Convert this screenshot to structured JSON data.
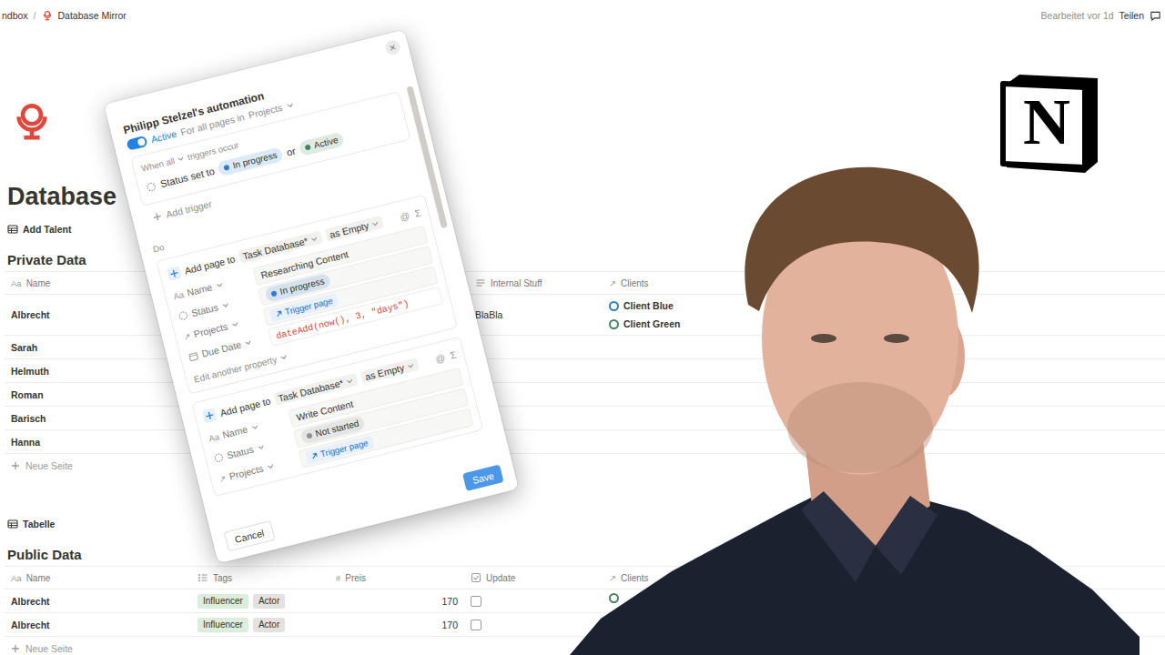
{
  "breadcrumb": {
    "items": [
      {
        "label": "ndbox"
      },
      {
        "label": "Database Mirror"
      }
    ],
    "separator": "/"
  },
  "topbar": {
    "edited": "Bearbeitet vor 1d",
    "share": "Teilen"
  },
  "page": {
    "title": "Database"
  },
  "sections": [
    {
      "view": "Add Talent",
      "heading": "Private Data",
      "columns": [
        {
          "label": "Name",
          "kind": "title",
          "icon": "Aa"
        },
        {
          "label": "Internal Stuff",
          "kind": "text"
        },
        {
          "label": "Clients",
          "kind": "relation",
          "icon": "↗"
        }
      ],
      "rows": [
        {
          "cells": [
            "Albrecht",
            "BlaBla",
            [
              {
                "label": "Client Blue",
                "color": "#2f7fb8"
              },
              {
                "label": "Client Green",
                "color": "#448361"
              }
            ]
          ]
        },
        {
          "cells": [
            "Sarah"
          ]
        },
        {
          "cells": [
            "Helmuth"
          ]
        },
        {
          "cells": [
            "Roman"
          ]
        },
        {
          "cells": [
            "Barisch"
          ]
        },
        {
          "cells": [
            "Hanna"
          ]
        }
      ],
      "new_page": "Neue Seite"
    },
    {
      "view": "Tabelle",
      "heading": "Public Data",
      "columns": [
        {
          "label": "Name",
          "kind": "title",
          "icon": "Aa"
        },
        {
          "label": "Tags",
          "kind": "multi"
        },
        {
          "label": "Preis",
          "kind": "number",
          "icon": "#"
        },
        {
          "label": "Update",
          "kind": "checkbox"
        },
        {
          "label": "Clients",
          "kind": "relation",
          "icon": "↗"
        }
      ],
      "rows": [
        {
          "cells": [
            "Albrecht",
            [
              {
                "label": "Influencer",
                "color": "#dbeddb"
              },
              {
                "label": "Actor",
                "color": "#e3e2e0"
              }
            ],
            "170",
            false,
            [
              {
                "color": "#448361"
              }
            ]
          ]
        },
        {
          "cells": [
            "Albrecht",
            [
              {
                "label": "Influencer",
                "color": "#dbeddb"
              },
              {
                "label": "Actor",
                "color": "#e3e2e0"
              }
            ],
            "170",
            false
          ]
        }
      ],
      "new_page": "Neue Seite"
    }
  ],
  "automation": {
    "close": "×",
    "title": "Philipp Stelzel's automation",
    "active": true,
    "active_label": "Active",
    "scope": "For all pages in",
    "scope_db": "Projects",
    "when": "When",
    "mode": "all",
    "when_suffix": "triggers occur",
    "triggers": [
      {
        "prefix": "Status set to",
        "joiner": "or",
        "values": [
          {
            "label": "In progress",
            "color": "#2e7cd1"
          },
          {
            "label": "Active",
            "color": "#448361"
          }
        ]
      }
    ],
    "add_trigger": "Add trigger",
    "do_label": "Do",
    "actions": [
      {
        "verb": "Add page to",
        "database": "Task Database*",
        "template": "as Empty",
        "tools": [
          "@",
          "Σ"
        ],
        "properties": [
          {
            "label": "Name",
            "icon": "Aa",
            "kind": "text",
            "value": "Researching Content"
          },
          {
            "label": "Status",
            "kind": "status",
            "value": "In progress",
            "color": "#2e7cd1"
          },
          {
            "label": "Projects",
            "icon": "↗",
            "kind": "relation",
            "value": "Trigger page"
          },
          {
            "label": "Due Date",
            "kind": "date",
            "value": "dateAdd(now(), 3, \"days\")"
          }
        ],
        "edit_more": "Edit another property"
      },
      {
        "verb": "Add page to",
        "database": "Task Database*",
        "template": "as Empty",
        "tools": [
          "@",
          "Σ"
        ],
        "properties": [
          {
            "label": "Name",
            "icon": "Aa",
            "kind": "text",
            "value": "Write Content"
          },
          {
            "label": "Status",
            "kind": "status",
            "value": "Not started",
            "color": "#91918e"
          },
          {
            "label": "Projects",
            "icon": "↗",
            "kind": "relation",
            "value": "Trigger page"
          }
        ]
      }
    ],
    "cancel": "Cancel",
    "save": "Save"
  },
  "logo": {
    "letter": "N"
  }
}
